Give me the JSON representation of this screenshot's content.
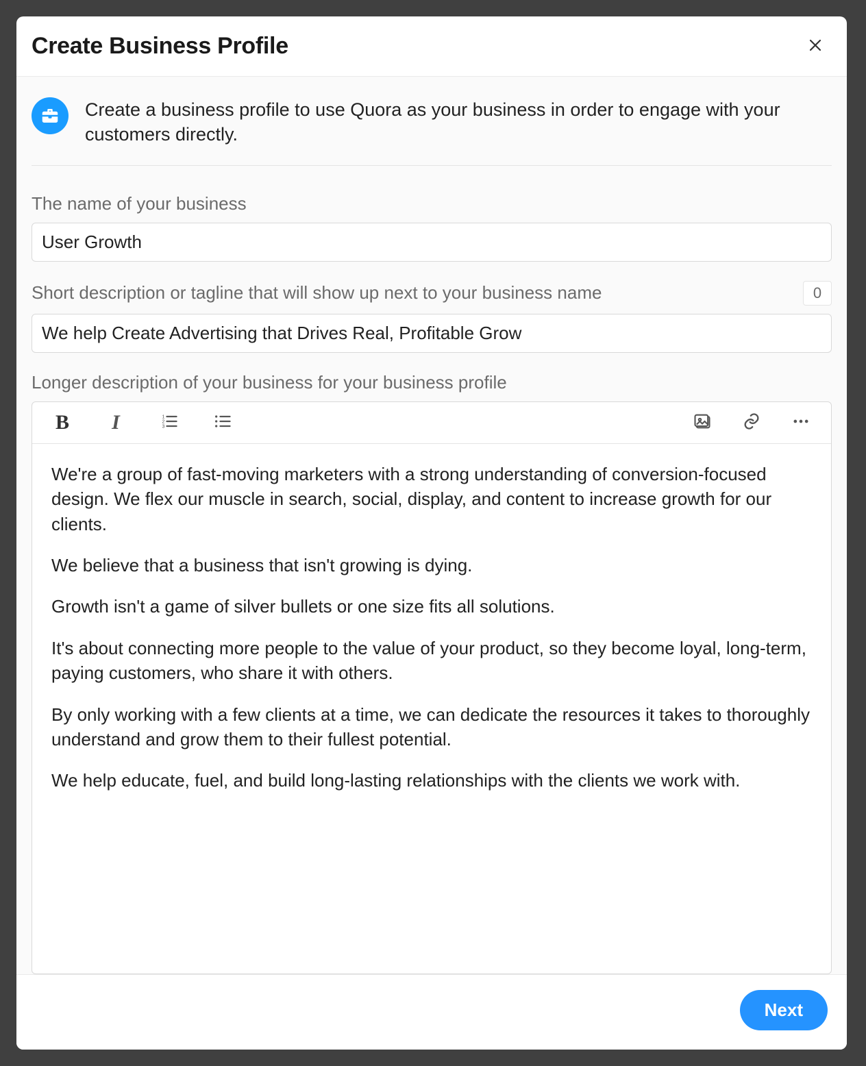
{
  "modal": {
    "title": "Create Business Profile",
    "intro": "Create a business profile to use Quora as your business in order to engage with your customers directly.",
    "next_label": "Next"
  },
  "fields": {
    "name": {
      "label": "The name of your business",
      "value": "User Growth"
    },
    "tagline": {
      "label": "Short description or tagline that will show up next to your business name",
      "value": "We help Create Advertising that Drives Real, Profitable Grow",
      "remaining": "0"
    },
    "description": {
      "label": "Longer description of your business for your business profile",
      "paragraphs": {
        "p1": "We're a group of fast-moving marketers with a strong understanding of conversion-focused design. We flex our muscle in search, social, display, and content to increase growth for our clients.",
        "p2": "We believe that a business that isn't growing is dying.",
        "p3": "Growth isn't a game of silver bullets or one size fits all solutions.",
        "p4": "It's about connecting more people to the value of your product, so they become loyal, long-term, paying customers, who share it with others.",
        "p5": "By only working with a few clients at a time, we can dedicate the resources it takes to thoroughly understand and grow them to their fullest potential.",
        "p6": "We help educate, fuel, and build long-lasting relationships with the clients we work with."
      }
    }
  }
}
